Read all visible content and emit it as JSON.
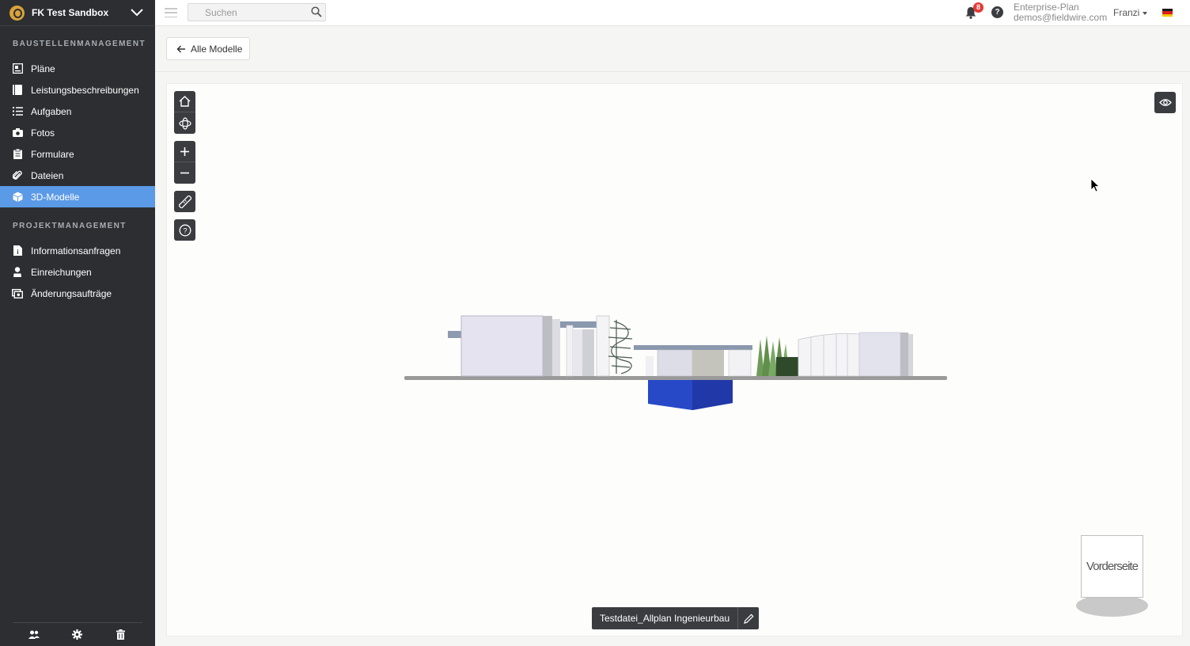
{
  "project": {
    "name": "FK Test Sandbox"
  },
  "sidebar": {
    "section_construction": "BAUSTELLENMANAGEMENT",
    "construction_items": [
      {
        "label": "Pläne",
        "icon": "plans-icon"
      },
      {
        "label": "Leistungsbeschreibungen",
        "icon": "specifications-icon"
      },
      {
        "label": "Aufgaben",
        "icon": "tasks-icon"
      },
      {
        "label": "Fotos",
        "icon": "camera-icon"
      },
      {
        "label": "Formulare",
        "icon": "clipboard-icon"
      },
      {
        "label": "Dateien",
        "icon": "paperclip-icon"
      },
      {
        "label": "3D-Modelle",
        "icon": "cube-icon",
        "active": true
      }
    ],
    "section_project": "PROJEKTMANAGEMENT",
    "project_items": [
      {
        "label": "Informationsanfragen",
        "icon": "rfi-icon"
      },
      {
        "label": "Einreichungen",
        "icon": "submittal-icon"
      },
      {
        "label": "Änderungsaufträge",
        "icon": "change-order-icon"
      }
    ],
    "footer_icons": [
      "people-icon",
      "gear-icon",
      "trash-icon"
    ]
  },
  "topbar": {
    "search_placeholder": "Suchen",
    "notifications_count": "8",
    "help_label": "?",
    "plan_name": "Enterprise-Plan",
    "account_email": "demos@fieldwire.com",
    "user_name": "Franzi",
    "language_flag": "german-flag-icon"
  },
  "content": {
    "back_label": "Alle Modelle",
    "model_name": "Testdatei_Allplan Ingenieurbau",
    "viewcube_label": "Vorderseite",
    "tools": [
      "home-icon",
      "orbit-icon",
      "zoom-in-icon",
      "zoom-out-icon",
      "measure-icon",
      "help-icon"
    ]
  },
  "colors": {
    "sidebar_bg": "#2c2e32",
    "active_item": "#5b9ae6",
    "toolbar_btn": "#3a3c40",
    "notification_badge": "#e53935",
    "model_foundation": "#2749c7"
  }
}
